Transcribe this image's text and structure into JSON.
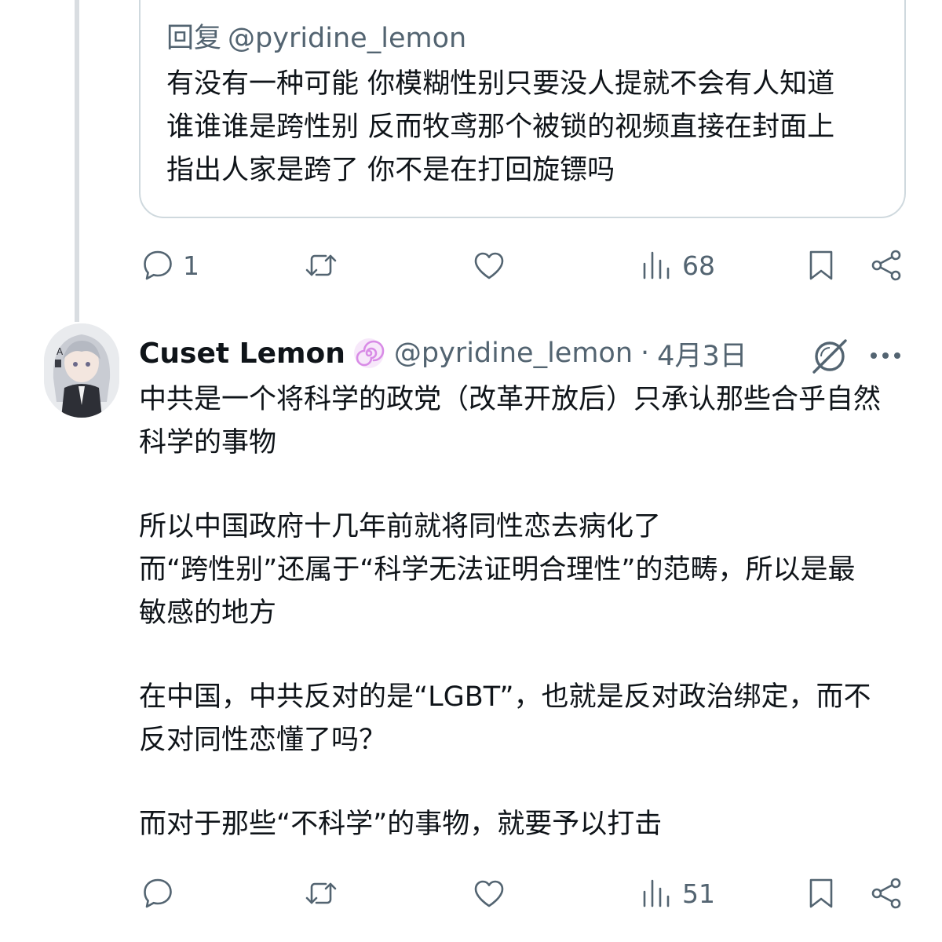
{
  "quoted_reply": {
    "reply_prefix": "回复",
    "reply_handle": "@pyridine_lemon",
    "lines": [
      "有没有一种可能 你模糊性别只要没人提就不会有人知道",
      "谁谁谁是跨性别 反而牧鸢那个被锁的视频直接在封面上",
      "指出人家是跨了 你不是在打回旋镖吗"
    ]
  },
  "actions_top": {
    "reply_count": "1",
    "views_count": "68"
  },
  "tweet": {
    "display_name": "Cuset Lemon",
    "handle": "@pyridine_lemon",
    "separator": "·",
    "date": "4月3日",
    "paragraphs": [
      [
        "中共是一个将科学的政党（改革开放后）只承认那些合乎自然",
        "科学的事物"
      ],
      [
        "所以中国政府十几年前就将同性恋去病化了",
        "而“跨性别”还属于“科学无法证明合理性”的范畴，所以是最",
        "敏感的地方"
      ],
      [
        "在中国，中共反对的是“LGBT”，也就是反对政治绑定，而不",
        "反对同性恋懂了吗？"
      ],
      [
        "而对于那些“不科学”的事物，就要予以打击"
      ]
    ]
  },
  "actions_bottom": {
    "views_count": "51"
  },
  "icons": {
    "reply": "speech-bubble-icon",
    "retweet": "retweet-arrows-icon",
    "like": "heart-icon",
    "views": "bar-chart-icon",
    "bookmark": "bookmark-icon",
    "share": "share-icon",
    "verified": "spiral-badge-icon",
    "grok": "grok-slash-circle-icon",
    "more": "ellipsis-icon"
  },
  "colors": {
    "text": "#0f1419",
    "secondary": "#536471",
    "border": "#cfd9de",
    "thread_line": "#d9dde1",
    "badge": "#d88be6"
  }
}
